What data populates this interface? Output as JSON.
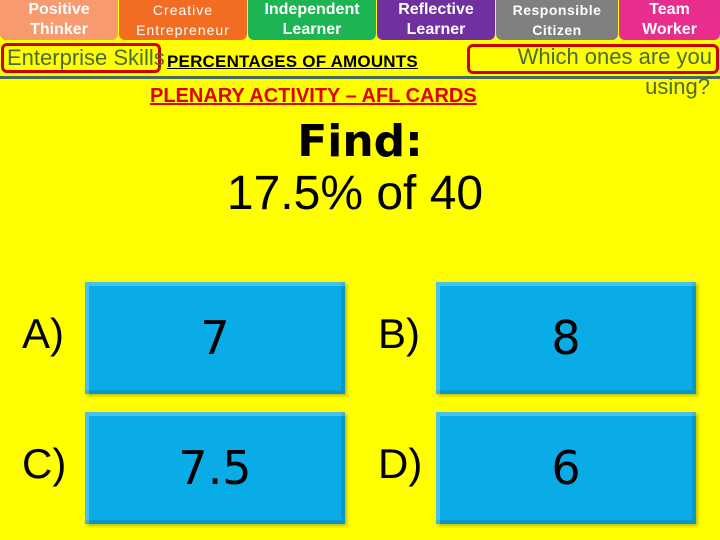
{
  "skills_tabs": [
    {
      "line1": "Positive",
      "line2": "Thinker",
      "color": "#f79a6d"
    },
    {
      "line1": "Creative",
      "line2": "Entrepreneur",
      "color": "#f26c21"
    },
    {
      "line1": "Independent",
      "line2": "Learner",
      "color": "#1db454"
    },
    {
      "line1": "Reflective",
      "line2": "Learner",
      "color": "#7030a0"
    },
    {
      "line1": "Responsible",
      "line2": "Citizen",
      "color": "#808080"
    },
    {
      "line1": "Team",
      "line2": "Worker",
      "color": "#e92d8c"
    }
  ],
  "enterprise_label": "Enterprise Skills",
  "lesson_title": "PERCENTAGES OF AMOUNTS",
  "which_prompt_line1": "Which ones are you",
  "which_prompt_line2": "using?",
  "plenary_title": "PLENARY ACTIVITY – AFL CARDS",
  "question": {
    "heading": "Find:",
    "expression": "17.5% of 40"
  },
  "options": [
    {
      "label": "A)",
      "value": "7"
    },
    {
      "label": "B)",
      "value": "8"
    },
    {
      "label": "C)",
      "value": "7.5"
    },
    {
      "label": "D)",
      "value": "6"
    }
  ],
  "colors": {
    "background": "#ffff00",
    "card": "#0aace8",
    "plenary_red": "#e00000",
    "box_border": "#cc0000"
  }
}
